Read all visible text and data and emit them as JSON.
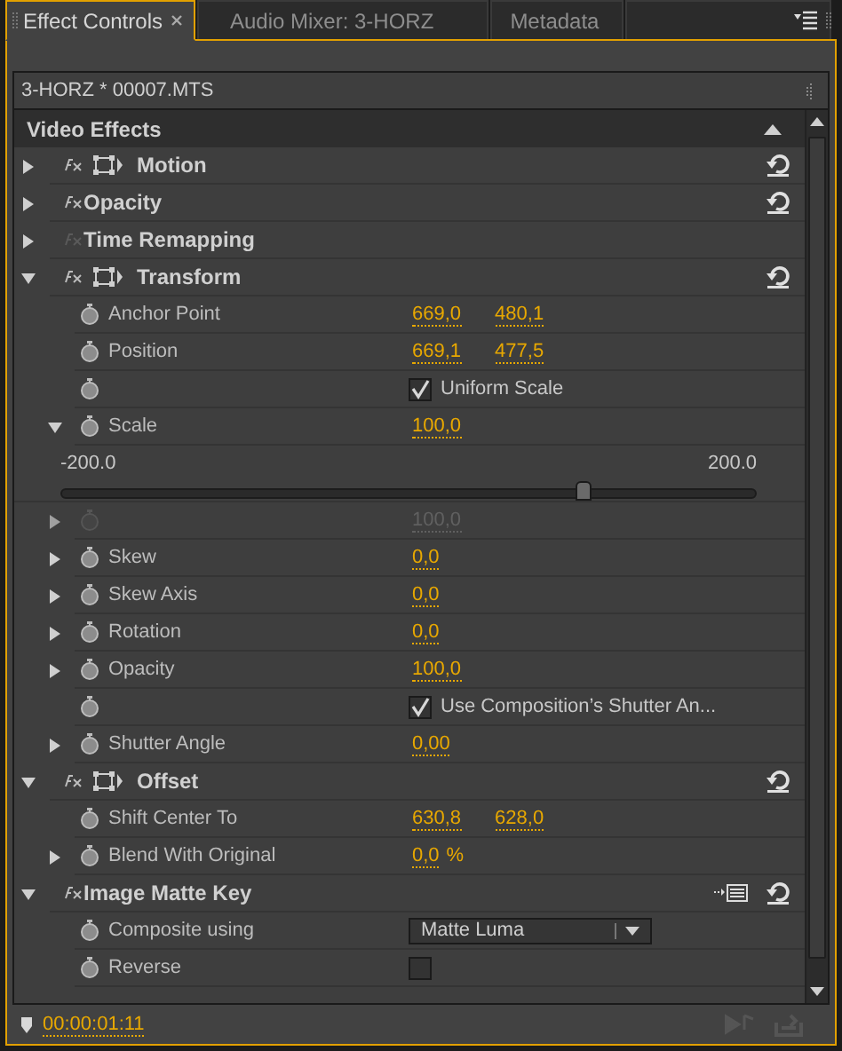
{
  "tabs": [
    {
      "label": "Effect Controls",
      "selected": true,
      "closable": true
    },
    {
      "label": "Audio Mixer: 3-HORZ",
      "selected": false,
      "closable": false
    },
    {
      "label": "Metadata",
      "selected": false,
      "closable": false
    }
  ],
  "clip_header": "3-HORZ * 00007.MTS",
  "section": "Video Effects",
  "effects": [
    {
      "name": "Motion",
      "expanded": false,
      "fx_enabled": true,
      "transform_icon": true,
      "reset": true,
      "keyframe_menu": false
    },
    {
      "name": "Opacity",
      "expanded": false,
      "fx_enabled": true,
      "transform_icon": false,
      "reset": true,
      "keyframe_menu": false
    },
    {
      "name": "Time Remapping",
      "expanded": false,
      "fx_enabled": false,
      "transform_icon": false,
      "reset": false,
      "keyframe_menu": false
    },
    {
      "name": "Transform",
      "expanded": true,
      "fx_enabled": true,
      "transform_icon": true,
      "reset": true,
      "keyframe_menu": false,
      "children": [
        {
          "kind": "value",
          "label": "Anchor Point",
          "disabled": false,
          "values": [
            "669,0",
            "480,1"
          ]
        },
        {
          "kind": "value",
          "label": "Position",
          "disabled": false,
          "values": [
            "669,1",
            "477,5"
          ]
        },
        {
          "kind": "checkbox",
          "disabled": false,
          "text": "Uniform Scale",
          "checked": true
        },
        {
          "kind": "value",
          "label": "Scale",
          "expanded": true,
          "disabled": false,
          "values": [
            "100,0"
          ],
          "slider": {
            "min": "-200.0",
            "max": "200.0",
            "level": 0.75
          }
        },
        {
          "kind": "value",
          "expanded": false,
          "disabled": true,
          "values": [
            "100,0"
          ]
        },
        {
          "kind": "value",
          "label": "Skew",
          "expanded": false,
          "disabled": false,
          "values": [
            "0,0"
          ]
        },
        {
          "kind": "value",
          "label": "Skew Axis",
          "expanded": false,
          "disabled": false,
          "values": [
            "0,0"
          ]
        },
        {
          "kind": "value",
          "label": "Rotation",
          "expanded": false,
          "disabled": false,
          "values": [
            "0,0"
          ]
        },
        {
          "kind": "value",
          "label": "Opacity",
          "expanded": false,
          "disabled": false,
          "values": [
            "100,0"
          ]
        },
        {
          "kind": "checkbox",
          "disabled": false,
          "text": "Use Composition’s Shutter An...",
          "checked": true
        },
        {
          "kind": "value",
          "label": "Shutter Angle",
          "expanded": false,
          "disabled": false,
          "values": [
            "0,00"
          ]
        }
      ]
    },
    {
      "name": "Offset",
      "expanded": true,
      "fx_enabled": true,
      "transform_icon": true,
      "reset": true,
      "keyframe_menu": false,
      "children": [
        {
          "kind": "value",
          "label": "Shift Center To",
          "disabled": false,
          "values": [
            "630,8",
            "628,0"
          ]
        },
        {
          "kind": "value",
          "label": "Blend With Original",
          "expanded": false,
          "disabled": false,
          "values": [
            "0,0"
          ],
          "unit": "%"
        }
      ]
    },
    {
      "name": "Image Matte Key",
      "expanded": true,
      "fx_enabled": true,
      "transform_icon": false,
      "reset": true,
      "keyframe_menu": true,
      "children": [
        {
          "kind": "dropdown",
          "label": "Composite using",
          "disabled": false,
          "value": "Matte Luma"
        },
        {
          "kind": "checkbox",
          "label": "Reverse",
          "disabled": false,
          "checked": false
        }
      ]
    }
  ],
  "timecode": "00:00:01:11"
}
